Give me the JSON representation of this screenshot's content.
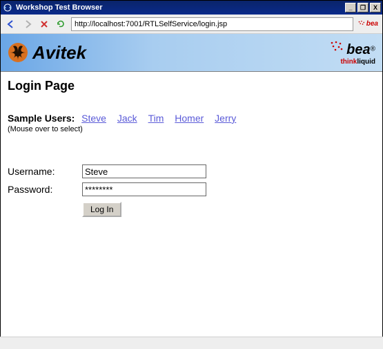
{
  "window": {
    "title": "Workshop Test Browser",
    "controls": {
      "min": "_",
      "max": "❐",
      "close": "X"
    }
  },
  "toolbar": {
    "url": "http://localhost:7001/RTLSelfService/login.jsp"
  },
  "banner": {
    "brand": "Avitek",
    "partner": "bea",
    "tagline_prefix": "think",
    "tagline_suffix": "liquid"
  },
  "page": {
    "title": "Login Page",
    "sample_label": "Sample Users:",
    "sample_users": [
      "Steve",
      "Jack",
      "Tim",
      "Homer",
      "Jerry"
    ],
    "hint": "(Mouse over to select)",
    "username_label": "Username:",
    "username_value": "Steve",
    "password_label": "Password:",
    "password_value": "********",
    "login_label": "Log In"
  }
}
